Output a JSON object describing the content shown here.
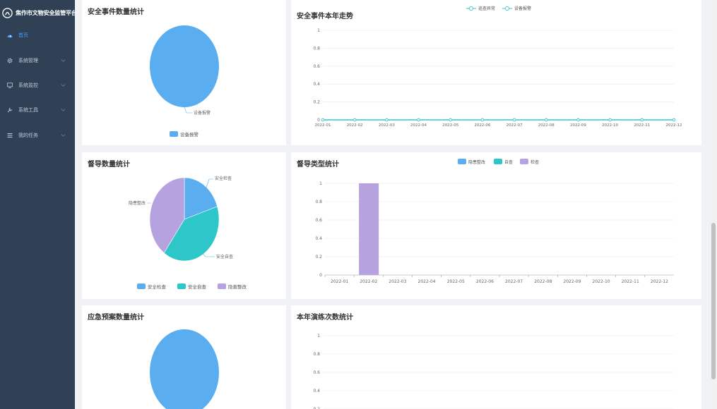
{
  "app": {
    "title": "焦作市文物安全监管平台"
  },
  "sidebar": {
    "items": [
      {
        "label": "首页",
        "icon": "dashboard-icon",
        "active": true
      },
      {
        "label": "系统管理",
        "icon": "gear-icon",
        "active": false
      },
      {
        "label": "系统监控",
        "icon": "monitor-icon",
        "active": false
      },
      {
        "label": "系统工具",
        "icon": "tool-icon",
        "active": false
      },
      {
        "label": "我的任务",
        "icon": "task-list-icon",
        "active": false
      }
    ]
  },
  "colors": {
    "blue": "#5aaef0",
    "teal": "#2ec7c9",
    "purple": "#b6a2de",
    "line": "#2ec7c9",
    "accent": "#409eff"
  },
  "panels": {
    "safety_event_count": {
      "title": "安全事件数量统计",
      "chart_data": {
        "type": "pie",
        "slices": [
          {
            "name": "设备报警",
            "value": 1
          }
        ],
        "legend": [
          "设备报警"
        ],
        "legend_position": "bottom"
      }
    },
    "safety_event_trend": {
      "title": "安全事件本年走势",
      "chart_data": {
        "type": "line",
        "x": [
          "2022-01",
          "2022-02",
          "2022-03",
          "2022-04",
          "2022-05",
          "2022-06",
          "2022-07",
          "2022-08",
          "2022-09",
          "2022-10",
          "2022-11",
          "2022-12"
        ],
        "series": [
          {
            "name": "巡查异常",
            "values": [
              0,
              0,
              0,
              0,
              0,
              0,
              0,
              0,
              0,
              0,
              0,
              0
            ]
          },
          {
            "name": "设备报警",
            "values": [
              0,
              0,
              0,
              0,
              0,
              0,
              0,
              0,
              0,
              0,
              0,
              0
            ]
          }
        ],
        "yticks": [
          "0",
          "0.2",
          "0.4",
          "0.6",
          "0.8",
          "1"
        ],
        "ylim": [
          0,
          1
        ],
        "grid": true,
        "legend_position": "top"
      }
    },
    "supervision_count": {
      "title": "督导数量统计",
      "chart_data": {
        "type": "pie",
        "slices": [
          {
            "name": "安全检查",
            "value": 1
          },
          {
            "name": "安全自查",
            "value": 2
          },
          {
            "name": "隐患整改",
            "value": 2
          }
        ],
        "legend": [
          "安全检查",
          "安全自查",
          "隐患整改"
        ],
        "legend_position": "bottom"
      }
    },
    "supervision_type": {
      "title": "督导类型统计",
      "chart_data": {
        "type": "bar",
        "categories": [
          "2022-01",
          "2022-02",
          "2022-03",
          "2022-04",
          "2022-05",
          "2022-06",
          "2022-07",
          "2022-08",
          "2022-09",
          "2022-10",
          "2022-11",
          "2022-12"
        ],
        "series": [
          {
            "name": "隐患整改",
            "values": [
              0,
              0,
              0,
              0,
              0,
              0,
              0,
              0,
              0,
              0,
              0,
              0
            ]
          },
          {
            "name": "自查",
            "values": [
              0,
              0,
              0,
              0,
              0,
              0,
              0,
              0,
              0,
              0,
              0,
              0
            ]
          },
          {
            "name": "检查",
            "values": [
              0,
              1,
              0,
              0,
              0,
              0,
              0,
              0,
              0,
              0,
              0,
              0
            ]
          }
        ],
        "yticks": [
          "0",
          "0.2",
          "0.4",
          "0.6",
          "0.8",
          "1"
        ],
        "ylim": [
          0,
          1
        ],
        "grid": true,
        "legend_position": "top"
      }
    },
    "emergency_plan_count": {
      "title": "应急预案数量统计",
      "chart_data": {
        "type": "pie",
        "slices": [
          {
            "name": "",
            "value": 1
          }
        ]
      }
    },
    "drill_count": {
      "title": "本年演练次数统计",
      "chart_data": {
        "type": "line",
        "yticks": [
          "1",
          "0.8",
          "0.6",
          "0.4",
          "0.2"
        ],
        "ylim": [
          0,
          1
        ],
        "grid": true
      }
    }
  }
}
